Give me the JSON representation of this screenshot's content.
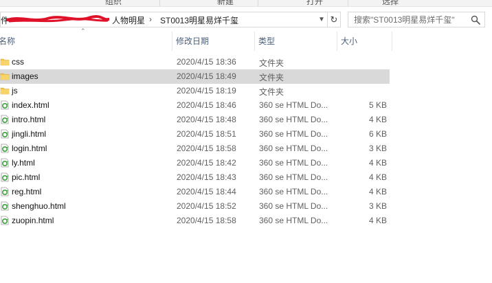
{
  "ribbon": {
    "labels": [
      "组织",
      "新建",
      "打开",
      "选择"
    ],
    "label_positions_hint": ""
  },
  "address": {
    "prefix": "件",
    "parent_folder": "人物明星",
    "current_folder": "ST0013明星易烊千玺",
    "separator": "›"
  },
  "search": {
    "placeholder": "搜索\"ST0013明星易烊千玺\""
  },
  "columns": {
    "name": "名称",
    "date": "修改日期",
    "type": "类型",
    "size": "大小"
  },
  "files": [
    {
      "name": "css",
      "date": "2020/4/15 18:36",
      "type": "文件夹",
      "size": "",
      "kind": "folder",
      "selected": false
    },
    {
      "name": "images",
      "date": "2020/4/15 18:49",
      "type": "文件夹",
      "size": "",
      "kind": "folder",
      "selected": true
    },
    {
      "name": "js",
      "date": "2020/4/15 18:19",
      "type": "文件夹",
      "size": "",
      "kind": "folder",
      "selected": false
    },
    {
      "name": "index.html",
      "date": "2020/4/15 18:46",
      "type": "360 se HTML Do...",
      "size": "5 KB",
      "kind": "html",
      "selected": false
    },
    {
      "name": "intro.html",
      "date": "2020/4/15 18:48",
      "type": "360 se HTML Do...",
      "size": "4 KB",
      "kind": "html",
      "selected": false
    },
    {
      "name": "jingli.html",
      "date": "2020/4/15 18:51",
      "type": "360 se HTML Do...",
      "size": "6 KB",
      "kind": "html",
      "selected": false
    },
    {
      "name": "login.html",
      "date": "2020/4/15 18:58",
      "type": "360 se HTML Do...",
      "size": "3 KB",
      "kind": "html",
      "selected": false
    },
    {
      "name": "ly.html",
      "date": "2020/4/15 18:42",
      "type": "360 se HTML Do...",
      "size": "4 KB",
      "kind": "html",
      "selected": false
    },
    {
      "name": "pic.html",
      "date": "2020/4/15 18:43",
      "type": "360 se HTML Do...",
      "size": "4 KB",
      "kind": "html",
      "selected": false
    },
    {
      "name": "reg.html",
      "date": "2020/4/15 18:44",
      "type": "360 se HTML Do...",
      "size": "4 KB",
      "kind": "html",
      "selected": false
    },
    {
      "name": "shenghuo.html",
      "date": "2020/4/15 18:52",
      "type": "360 se HTML Do...",
      "size": "3 KB",
      "kind": "html",
      "selected": false
    },
    {
      "name": "zuopin.html",
      "date": "2020/4/15 18:58",
      "type": "360 se HTML Do...",
      "size": "4 KB",
      "kind": "html",
      "selected": false
    }
  ],
  "colors": {
    "selected_row": "#d9d9d9",
    "folder_icon": "#f5c342",
    "html_icon_accent": "#3aa23a",
    "column_header_text": "#4c607a",
    "redaction": "#e0122a"
  },
  "icons": {
    "folder": "folder-icon",
    "html": "html-file-icon",
    "search": "search-icon",
    "refresh": "refresh-icon",
    "dropdown": "chevron-down-icon"
  }
}
